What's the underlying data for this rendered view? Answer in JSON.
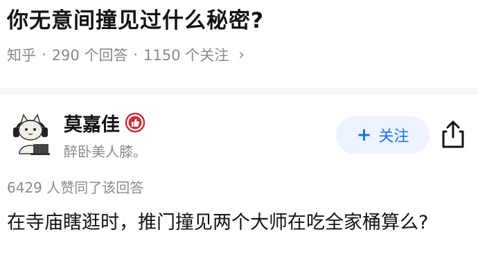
{
  "question": {
    "title": "你无意间撞见过什么秘密?",
    "source": "知乎",
    "answers_count": "290 个回答",
    "followers_count": "1150 个关注",
    "separator": "·",
    "chevron": "›"
  },
  "author": {
    "name": "莫嘉佳",
    "bio": "醉卧美人膝。",
    "avatar_icon": "cartoon-cat-with-headphones-icon",
    "badge_icon": "thumbs-up-badge-icon",
    "badge_color": "#c8323c"
  },
  "actions": {
    "follow_plus": "+",
    "follow_label": "关注",
    "share_icon": "share-icon"
  },
  "answer": {
    "likes": "6429 人赞同了该回答",
    "content": "在寺庙瞎逛时，推门撞见两个大师在吃全家桶算么?"
  },
  "colors": {
    "accent": "#1772f6",
    "follow_bg": "#eef4fd",
    "muted_text": "#8a8a8a"
  }
}
